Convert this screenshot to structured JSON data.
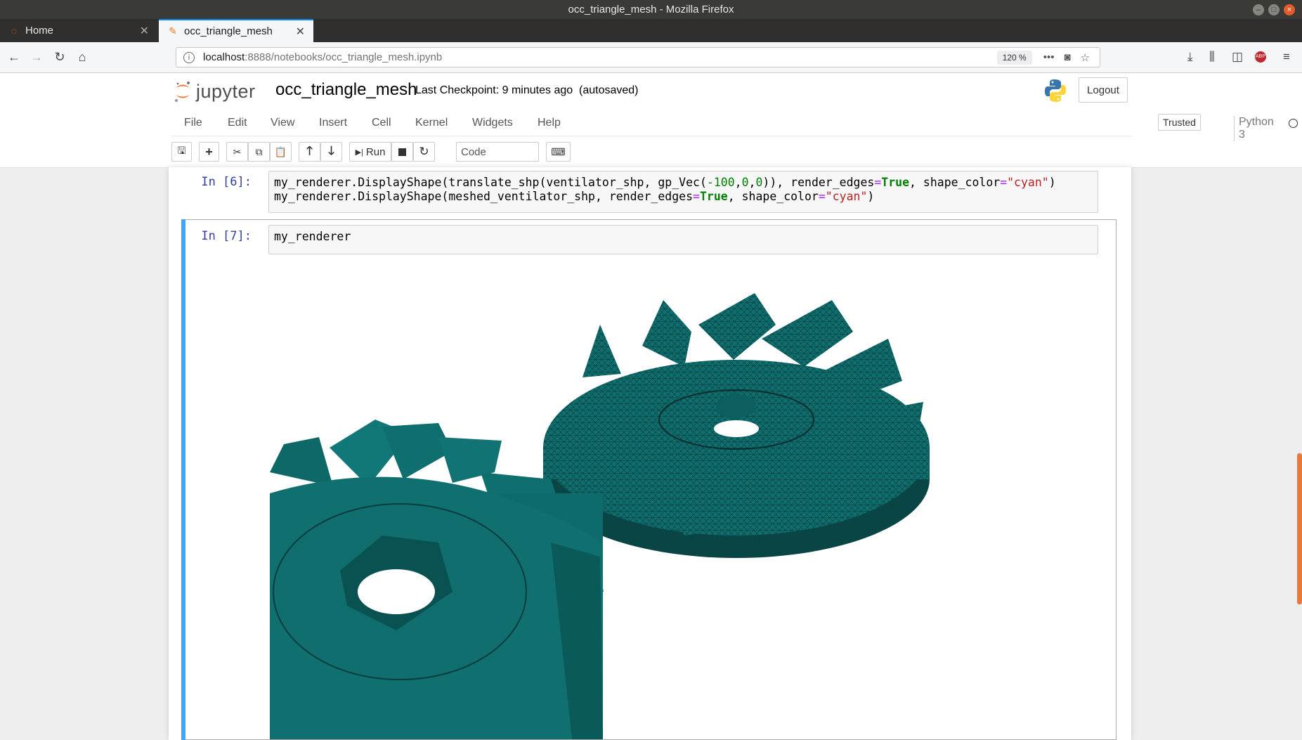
{
  "window": {
    "title": "occ_triangle_mesh - Mozilla Firefox"
  },
  "tabs": [
    {
      "label": "Home",
      "active": false
    },
    {
      "label": "occ_triangle_mesh",
      "active": true
    }
  ],
  "urlbar": {
    "host": "localhost",
    "path": ":8888/notebooks/occ_triangle_mesh.ipynb",
    "zoom": "120 %"
  },
  "jupyter": {
    "logo_text": "jupyter",
    "notebook_name": "occ_triangle_mesh",
    "checkpoint": "Last Checkpoint: 9 minutes ago",
    "autosave": "(autosaved)",
    "logout_label": "Logout"
  },
  "menu": {
    "items": [
      "File",
      "Edit",
      "View",
      "Insert",
      "Cell",
      "Kernel",
      "Widgets",
      "Help"
    ],
    "trusted_label": "Trusted",
    "kernel_name": "Python 3"
  },
  "toolbar": {
    "run_label": "Run",
    "cell_type": "Code"
  },
  "cells": [
    {
      "prompt": "In [6]:",
      "line1": {
        "a": "my_renderer.DisplayShape(translate_shp(ventilator_shp, gp_Vec(",
        "b": "-100",
        "c": ",",
        "d": "0",
        "e": ",",
        "f": "0",
        "g": ")), render_edges",
        "h": "=",
        "i": "True",
        "j": ", shape_color",
        "k": "=",
        "l": "\"cyan\"",
        "m": ")"
      },
      "line2": {
        "a": "my_renderer.DisplayShape(meshed_ventilator_shp, render_edges",
        "b": "=",
        "c": "True",
        "d": ", shape_color",
        "e": "=",
        "f": "\"cyan\"",
        "g": ")"
      }
    },
    {
      "prompt": "In [7]:",
      "code": "my_renderer"
    }
  ],
  "colors": {
    "accent": "#42a5f5",
    "prompt": "#303f9f",
    "shape": "#0f6f6f",
    "jupyter_orange": "#f37726"
  }
}
